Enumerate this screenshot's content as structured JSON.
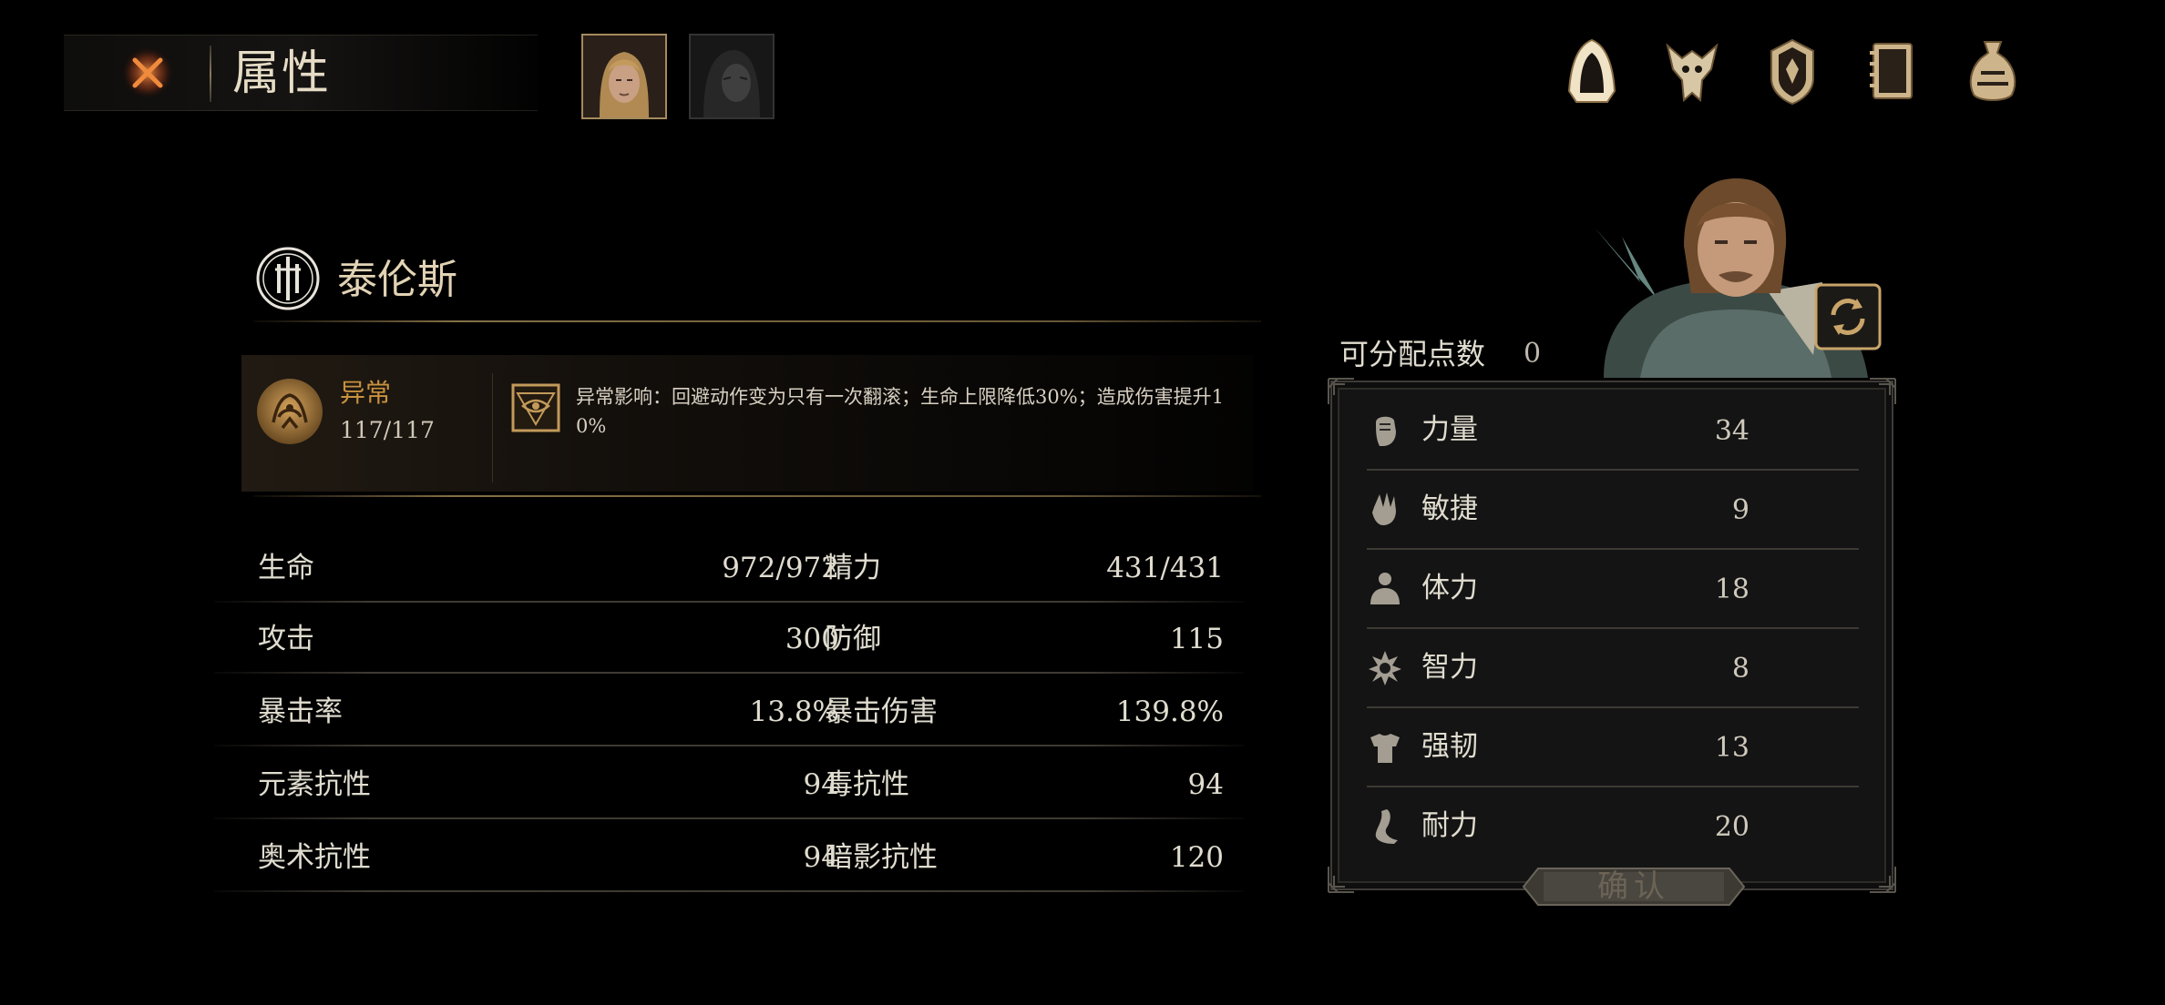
{
  "header": {
    "title": "属性"
  },
  "party": {
    "tabs": [
      {
        "name": "active-portrait"
      },
      {
        "name": "inactive-portrait"
      }
    ]
  },
  "nav_icons": [
    "hood-icon",
    "beast-skull-icon",
    "shield-crest-icon",
    "journal-icon",
    "pouch-icon"
  ],
  "character": {
    "name": "泰伦斯",
    "status": {
      "name": "异常",
      "value": "117/117",
      "effect_line1": "异常影响：回避动作变为只有一次翻滚；生命上限降低30%；造成伤害提升1",
      "effect_line2": "0%"
    }
  },
  "stats": [
    {
      "left_label": "生命",
      "left_value": "972/972",
      "right_label": "精力",
      "right_value": "431/431"
    },
    {
      "left_label": "攻击",
      "left_value": "300",
      "right_label": "防御",
      "right_value": "115"
    },
    {
      "left_label": "暴击率",
      "left_value": "13.8%",
      "right_label": "暴击伤害",
      "right_value": "139.8%"
    },
    {
      "left_label": "元素抗性",
      "left_value": "94",
      "right_label": "毒抗性",
      "right_value": "94"
    },
    {
      "left_label": "奥术抗性",
      "left_value": "94",
      "right_label": "暗影抗性",
      "right_value": "120"
    }
  ],
  "attributes": {
    "points_label": "可分配点数",
    "points_value": "0",
    "items": [
      {
        "name": "力量",
        "value": "34",
        "icon": "fist-icon"
      },
      {
        "name": "敏捷",
        "value": "9",
        "icon": "hand-icon"
      },
      {
        "name": "体力",
        "value": "18",
        "icon": "body-icon"
      },
      {
        "name": "智力",
        "value": "8",
        "icon": "mind-icon"
      },
      {
        "name": "强韧",
        "value": "13",
        "icon": "armor-icon"
      },
      {
        "name": "耐力",
        "value": "20",
        "icon": "leg-icon"
      }
    ],
    "confirm_label": "确认"
  },
  "colors": {
    "accent_gold": "#c8a26a",
    "status_orange": "#c8923f",
    "close_orange": "#e2642a"
  }
}
